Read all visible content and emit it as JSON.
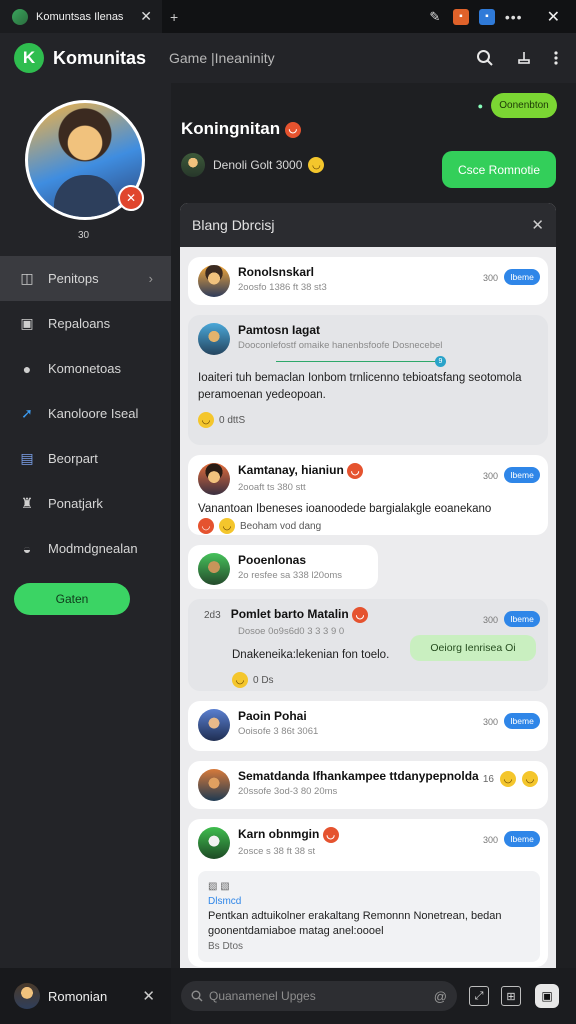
{
  "titlebar": {
    "tab_title": "Komuntsas Ilenas",
    "tab_close": "✕",
    "newtab": "+",
    "icons": [
      "edit-icon",
      "extension-orange-icon",
      "extension-blue-icon",
      "more-icon"
    ],
    "dots": "•••",
    "close": "✕"
  },
  "header": {
    "logo_letter": "K",
    "app_name": "Komunitas",
    "section": "Game |Ineaninity"
  },
  "sidebar": {
    "level": "30",
    "items": [
      {
        "label": "Penitops",
        "icon": "◫",
        "active": true,
        "arrow": "›"
      },
      {
        "label": "Repaloans",
        "icon": "▣"
      },
      {
        "label": "Komonetoas",
        "icon": "●"
      },
      {
        "label": "Kanoloore Iseal",
        "icon": "➚"
      },
      {
        "label": "Beorpart",
        "icon": "▤"
      },
      {
        "label": "Ponatjark",
        "icon": "♜"
      },
      {
        "label": "Modmdgnealan",
        "icon": "◒"
      }
    ],
    "cta": "Gaten"
  },
  "bottom_user": {
    "name": "Romonian",
    "close": "✕"
  },
  "composer": {
    "placeholder": "Quanamenel Upges"
  },
  "profile": {
    "online_label": "Oonenbton",
    "name": "Koningnitan",
    "sub_text": "Denoli Golt 3000",
    "join_label": "Csce Romnotie"
  },
  "panel": {
    "title": "Blang Dbrcisj",
    "close": "✕"
  },
  "posts": [
    {
      "name": "Ronolsnskarl",
      "time": "2oosfo 1386 ft 38 st3",
      "count": "300",
      "follow": "Ibeme",
      "avatar": "av1",
      "grey": false
    },
    {
      "name": "Pamtosn Iagat",
      "time": "Dooconlefostf omaike hanenbsfoofe Dosnecebel",
      "progress": "9",
      "body": "Ioaiteri tuh bemaclan Ionbom trnlicenno tebioatsfang seotomola peramoenan yedeopoan.",
      "reactions": "0 dttS",
      "avatar": "av2",
      "grey": true
    },
    {
      "name": "Kamtanay, hianiun",
      "time": "2ooaft ts 380 stt",
      "count": "300",
      "follow": "Ibeme",
      "body": "Vanantoan Ibeneses ioanoodede bargialakgle eoanekano",
      "reactions": "Beoham vod dang",
      "avatar": "av3",
      "grey": false
    },
    {
      "name": "Pooenlonas",
      "time": "2o resfee sa 338 l20oms",
      "avatar": "av4",
      "grey": false,
      "narrow": true
    },
    {
      "name": "Pomlet barto Matalin",
      "time": "Dosoe 0o9s6d0 3 3 3 9 0",
      "count": "300",
      "follow": "Ibeme",
      "side_label": "2d3",
      "body": "Dnakeneika:lekenian fon toelo.",
      "reply": "Oeiorg Ienrisea Oi",
      "reactions": "0 Ds",
      "avatar": "av2",
      "grey": true
    },
    {
      "name": "Paoin Pohai",
      "time": "Ooisofe 3 86t 3061",
      "count": "300",
      "follow": "Ibeme",
      "avatar": "av5",
      "grey": false
    },
    {
      "name": "Sematdanda Ifhankampee ttdanypepnolda",
      "time": "20ssofe 3od-3 80 20ms",
      "side": "16",
      "avatar": "av6",
      "grey": false
    },
    {
      "name": "Karn obnmgin",
      "time": "2osce s 38 ft 38 st",
      "count": "300",
      "follow": "Ibeme",
      "quote_icons": "▧ ▧",
      "quote_link": "Dlsmcd",
      "quote_text": "Pentkan adtuikolner erakaltang Remonnn Nonetrean, bedan goonentdamiaboe matag anel:oooel",
      "quote_footer": "Bs Dtos",
      "avatar": "av7",
      "grey": false
    }
  ]
}
